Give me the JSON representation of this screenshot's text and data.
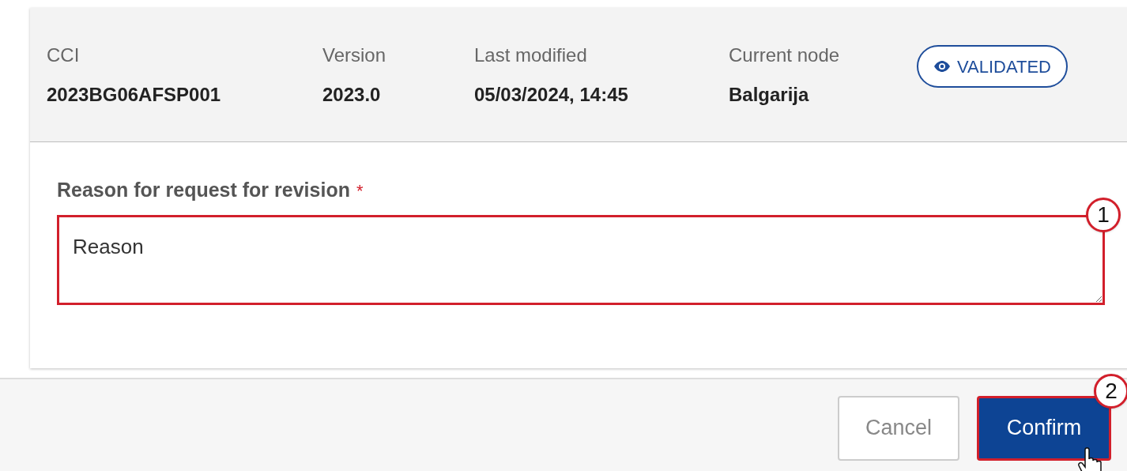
{
  "header": {
    "fields": [
      {
        "label": "CCI",
        "value": "2023BG06AFSP001"
      },
      {
        "label": "Version",
        "value": "2023.0"
      },
      {
        "label": "Last modified",
        "value": "05/03/2024, 14:45"
      },
      {
        "label": "Current node",
        "value": "Balgarija"
      }
    ],
    "status_badge": "VALIDATED"
  },
  "form": {
    "label": "Reason for request for revision",
    "required_mark": "*",
    "value": "Reason",
    "invalid": true,
    "callout": "1"
  },
  "buttons": [
    {
      "label": "Cancel",
      "kind": "secondary",
      "highlighted": false
    },
    {
      "label": "Confirm",
      "kind": "primary",
      "highlighted": true,
      "callout": "2"
    }
  ]
}
